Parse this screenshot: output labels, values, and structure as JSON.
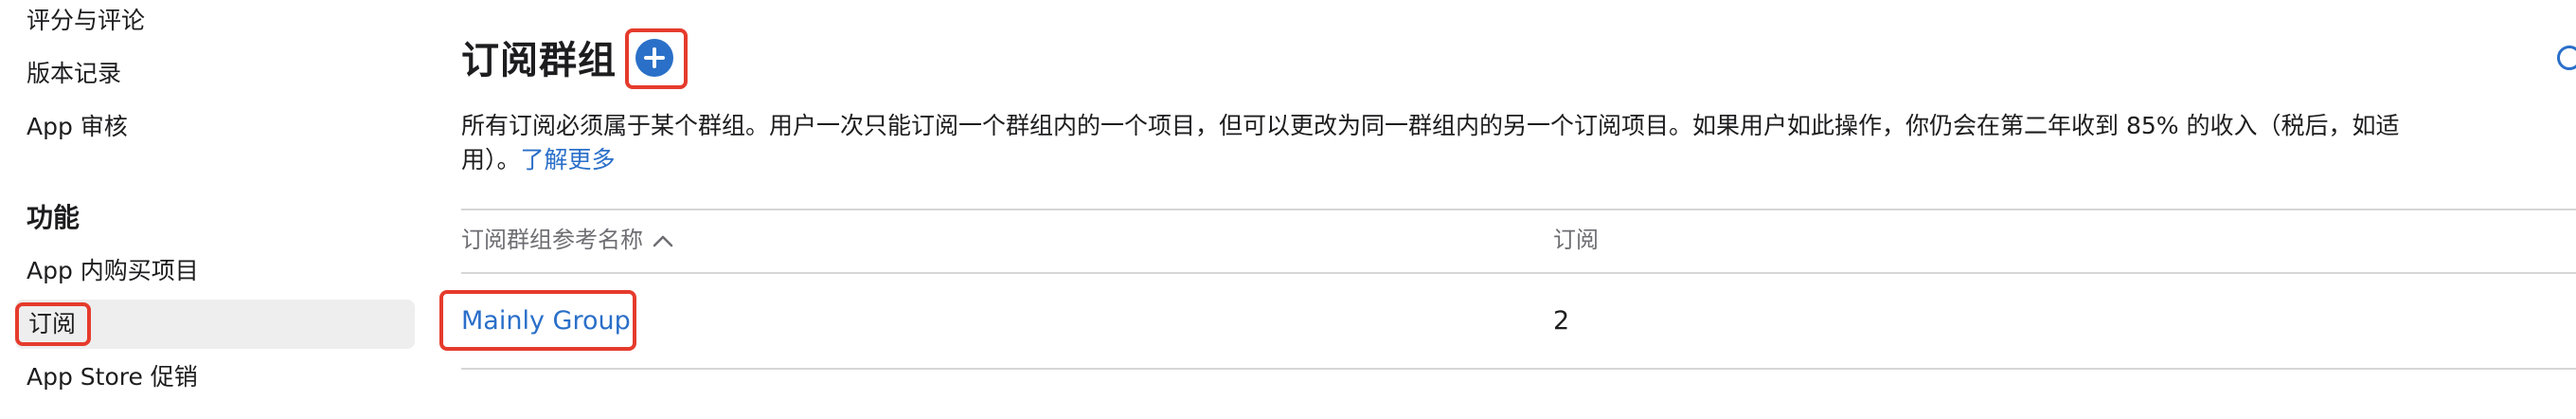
{
  "sidebar": {
    "items_top": [
      "评分与评论",
      "版本记录",
      "App 审核"
    ],
    "section_heading": "功能",
    "items_features": [
      "App 内购买项目",
      "订阅",
      "App Store 促销"
    ],
    "selected": "订阅"
  },
  "main": {
    "title": "订阅群组",
    "add_button_icon": "plus-circle-icon",
    "description_line1": "所有订阅必须属于某个群组。用户一次只能订阅一个群组内的一个项目，但可以更改为同一群组内的另一个订阅项目。如果用户如此操作，你仍会在第二年收到 85% 的收入（税后，如适",
    "description_line2_prefix": "用）。",
    "learn_more": "了解更多",
    "table": {
      "columns": [
        "订阅群组参考名称",
        "订阅"
      ],
      "sort_icon": "chevron-up-icon",
      "rows": [
        {
          "name": "Mainly Group",
          "count": "2"
        }
      ]
    }
  },
  "colors": {
    "accent": "#2a6fc9",
    "highlight": "#e53b2c",
    "selected_bg": "#eeeeee"
  }
}
